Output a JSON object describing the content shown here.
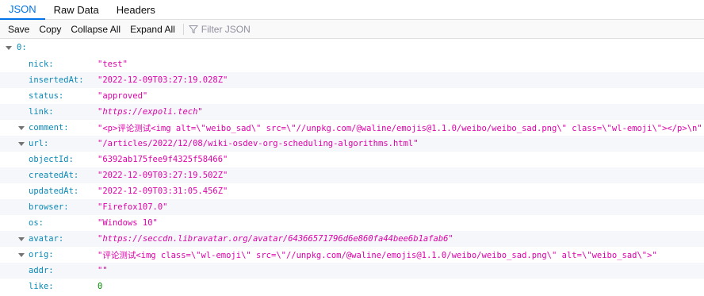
{
  "tabs": [
    {
      "label": "JSON"
    },
    {
      "label": "Raw Data"
    },
    {
      "label": "Headers"
    }
  ],
  "toolbar": {
    "save": "Save",
    "copy": "Copy",
    "collapse_all": "Collapse All",
    "expand_all": "Expand All",
    "filter_placeholder": "Filter JSON"
  },
  "tree": {
    "root_key": "0:",
    "rows": [
      {
        "key": "nick:",
        "value": "\"test\""
      },
      {
        "key": "insertedAt:",
        "value": "\"2022-12-09T03:27:19.028Z\""
      },
      {
        "key": "status:",
        "value": "\"approved\""
      },
      {
        "key": "link:",
        "value": "\"https://expoli.tech\""
      },
      {
        "key": "comment:",
        "value": "\"<p>评论测试<img alt=\\\"weibo_sad\\\" src=\\\"//unpkg.com/@waline/emojis@1.1.0/weibo/weibo_sad.png\\\" class=\\\"wl-emoji\\\"></p>\\n\""
      },
      {
        "key": "url:",
        "value": "\"/articles/2022/12/08/wiki-osdev-org-scheduling-algorithms.html\""
      },
      {
        "key": "objectId:",
        "value": "\"6392ab175fee9f4325f58466\""
      },
      {
        "key": "createdAt:",
        "value": "\"2022-12-09T03:27:19.502Z\""
      },
      {
        "key": "updatedAt:",
        "value": "\"2022-12-09T03:31:05.456Z\""
      },
      {
        "key": "browser:",
        "value": "\"Firefox107.0\""
      },
      {
        "key": "os:",
        "value": "\"Windows 10\""
      },
      {
        "key": "avatar:",
        "value": "\"https://seccdn.libravatar.org/avatar/64366571796d6e860fa44bee6b1afab6\""
      },
      {
        "key": "orig:",
        "value": "\"评论测试<img class=\\\"wl-emoji\\\" src=\\\"//unpkg.com/@waline/emojis@1.1.0/weibo/weibo_sad.png\\\" alt=\\\"weibo_sad\\\">\""
      },
      {
        "key": "addr:",
        "value": "\"\""
      },
      {
        "key": "like:",
        "value": "0"
      }
    ]
  },
  "colors": {
    "accent": "#0074e8",
    "key": "#0b89b6",
    "string": "#dd00a9",
    "number": "#058b00",
    "alt_row": "#f5f7fa"
  }
}
